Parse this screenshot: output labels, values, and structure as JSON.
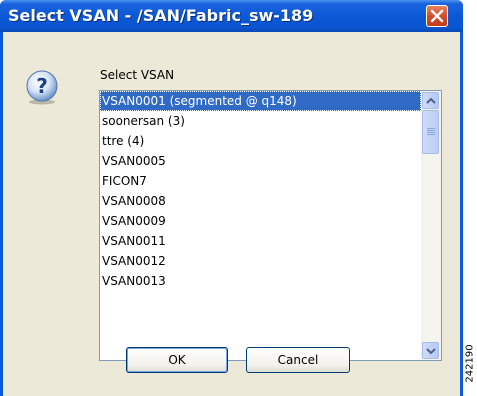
{
  "window": {
    "title": "Select VSAN - /SAN/Fabric_sw-189"
  },
  "dialog": {
    "icon": "question-icon",
    "list_label": "Select VSAN",
    "items": [
      "VSAN0001 (segmented @ q148)",
      "soonersan (3)",
      "ttre (4)",
      "VSAN0005",
      "FICON7",
      "VSAN0008",
      "VSAN0009",
      "VSAN0011",
      "VSAN0012",
      "VSAN0013"
    ],
    "selected_item": "VSAN0001 (segmented @ q148)",
    "ok_label": "OK",
    "cancel_label": "Cancel"
  },
  "figure_id": "242190",
  "colors": {
    "titlebar": "#0a55d0",
    "selection": "#316ac5",
    "dialog_bg": "#ece9d8",
    "close_button": "#d2482a"
  }
}
